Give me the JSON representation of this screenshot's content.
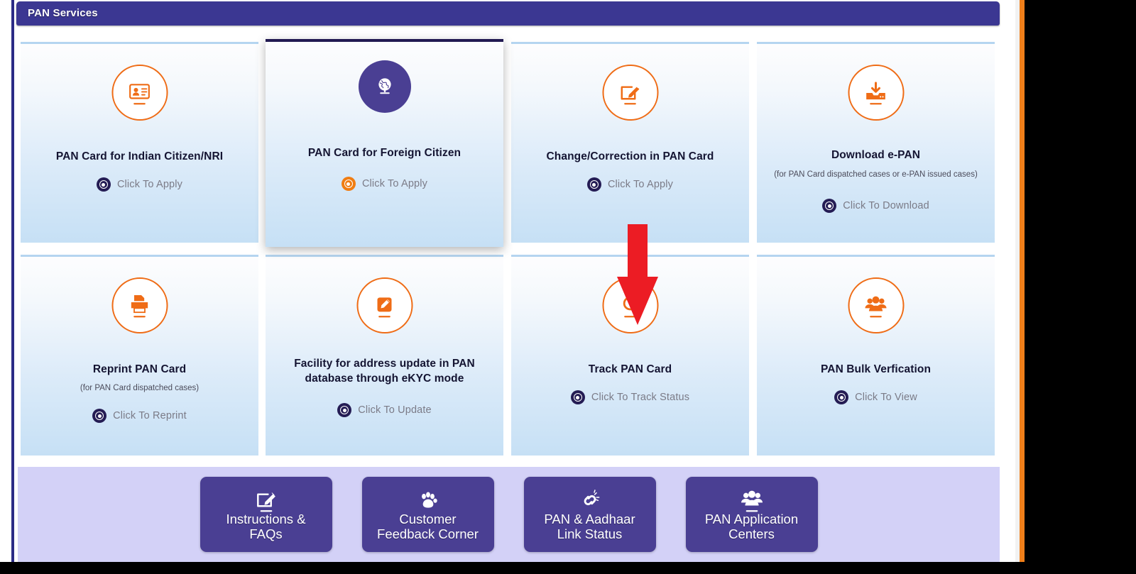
{
  "header": {
    "title": "PAN Services"
  },
  "accent": {
    "header_bg": "#3b3792",
    "orange": "#ef6c16",
    "purple": "#4a3f93",
    "card_border": "#b5d5f0",
    "footer_bg": "#d3d1f7",
    "arrow_red": "#ec1c24",
    "frame_orange": "#f07f1a",
    "frame_navy": "#2b2b86"
  },
  "cards": [
    {
      "title": "PAN Card for Indian Citizen/NRI",
      "subtitle": "",
      "cta": "Click To Apply",
      "icon": "id-card-icon",
      "state": "default"
    },
    {
      "title": "PAN Card for Foreign Citizen",
      "subtitle": "",
      "cta": "Click To Apply",
      "icon": "globe-icon",
      "state": "active"
    },
    {
      "title": "Change/Correction in PAN Card",
      "subtitle": "",
      "cta": "Click To Apply",
      "icon": "edit-square-icon",
      "state": "default"
    },
    {
      "title": "Download e-PAN",
      "subtitle": "(for PAN Card dispatched cases or e-PAN issued cases)",
      "cta": "Click To Download",
      "icon": "download-inbox-icon",
      "state": "default"
    },
    {
      "title": "Reprint PAN Card",
      "subtitle": "(for PAN Card dispatched cases)",
      "cta": "Click To Reprint",
      "icon": "printer-icon",
      "state": "default"
    },
    {
      "title": "Facility for address update in PAN database through eKYC mode",
      "subtitle": "",
      "cta": "Click To Update",
      "icon": "pencil-filled-icon",
      "state": "default"
    },
    {
      "title": "Track PAN Card",
      "subtitle": "",
      "cta": "Click To Track Status",
      "icon": "search-magnifier-icon",
      "state": "default"
    },
    {
      "title": "PAN Bulk Verfication",
      "subtitle": "",
      "cta": "Click To View",
      "icon": "group-people-icon",
      "state": "default"
    }
  ],
  "footer_buttons": [
    {
      "label": "Instructions &\nFAQs",
      "icon": "edit-square-icon"
    },
    {
      "label": "Customer\nFeedback Corner",
      "icon": "paw-print-icon"
    },
    {
      "label": "PAN & Aadhaar\nLink Status",
      "icon": "broken-link-icon"
    },
    {
      "label": "PAN Application\nCenters",
      "icon": "group-people-icon"
    }
  ],
  "annotation": {
    "type": "red-down-arrow",
    "points_to": "Track PAN Card"
  }
}
